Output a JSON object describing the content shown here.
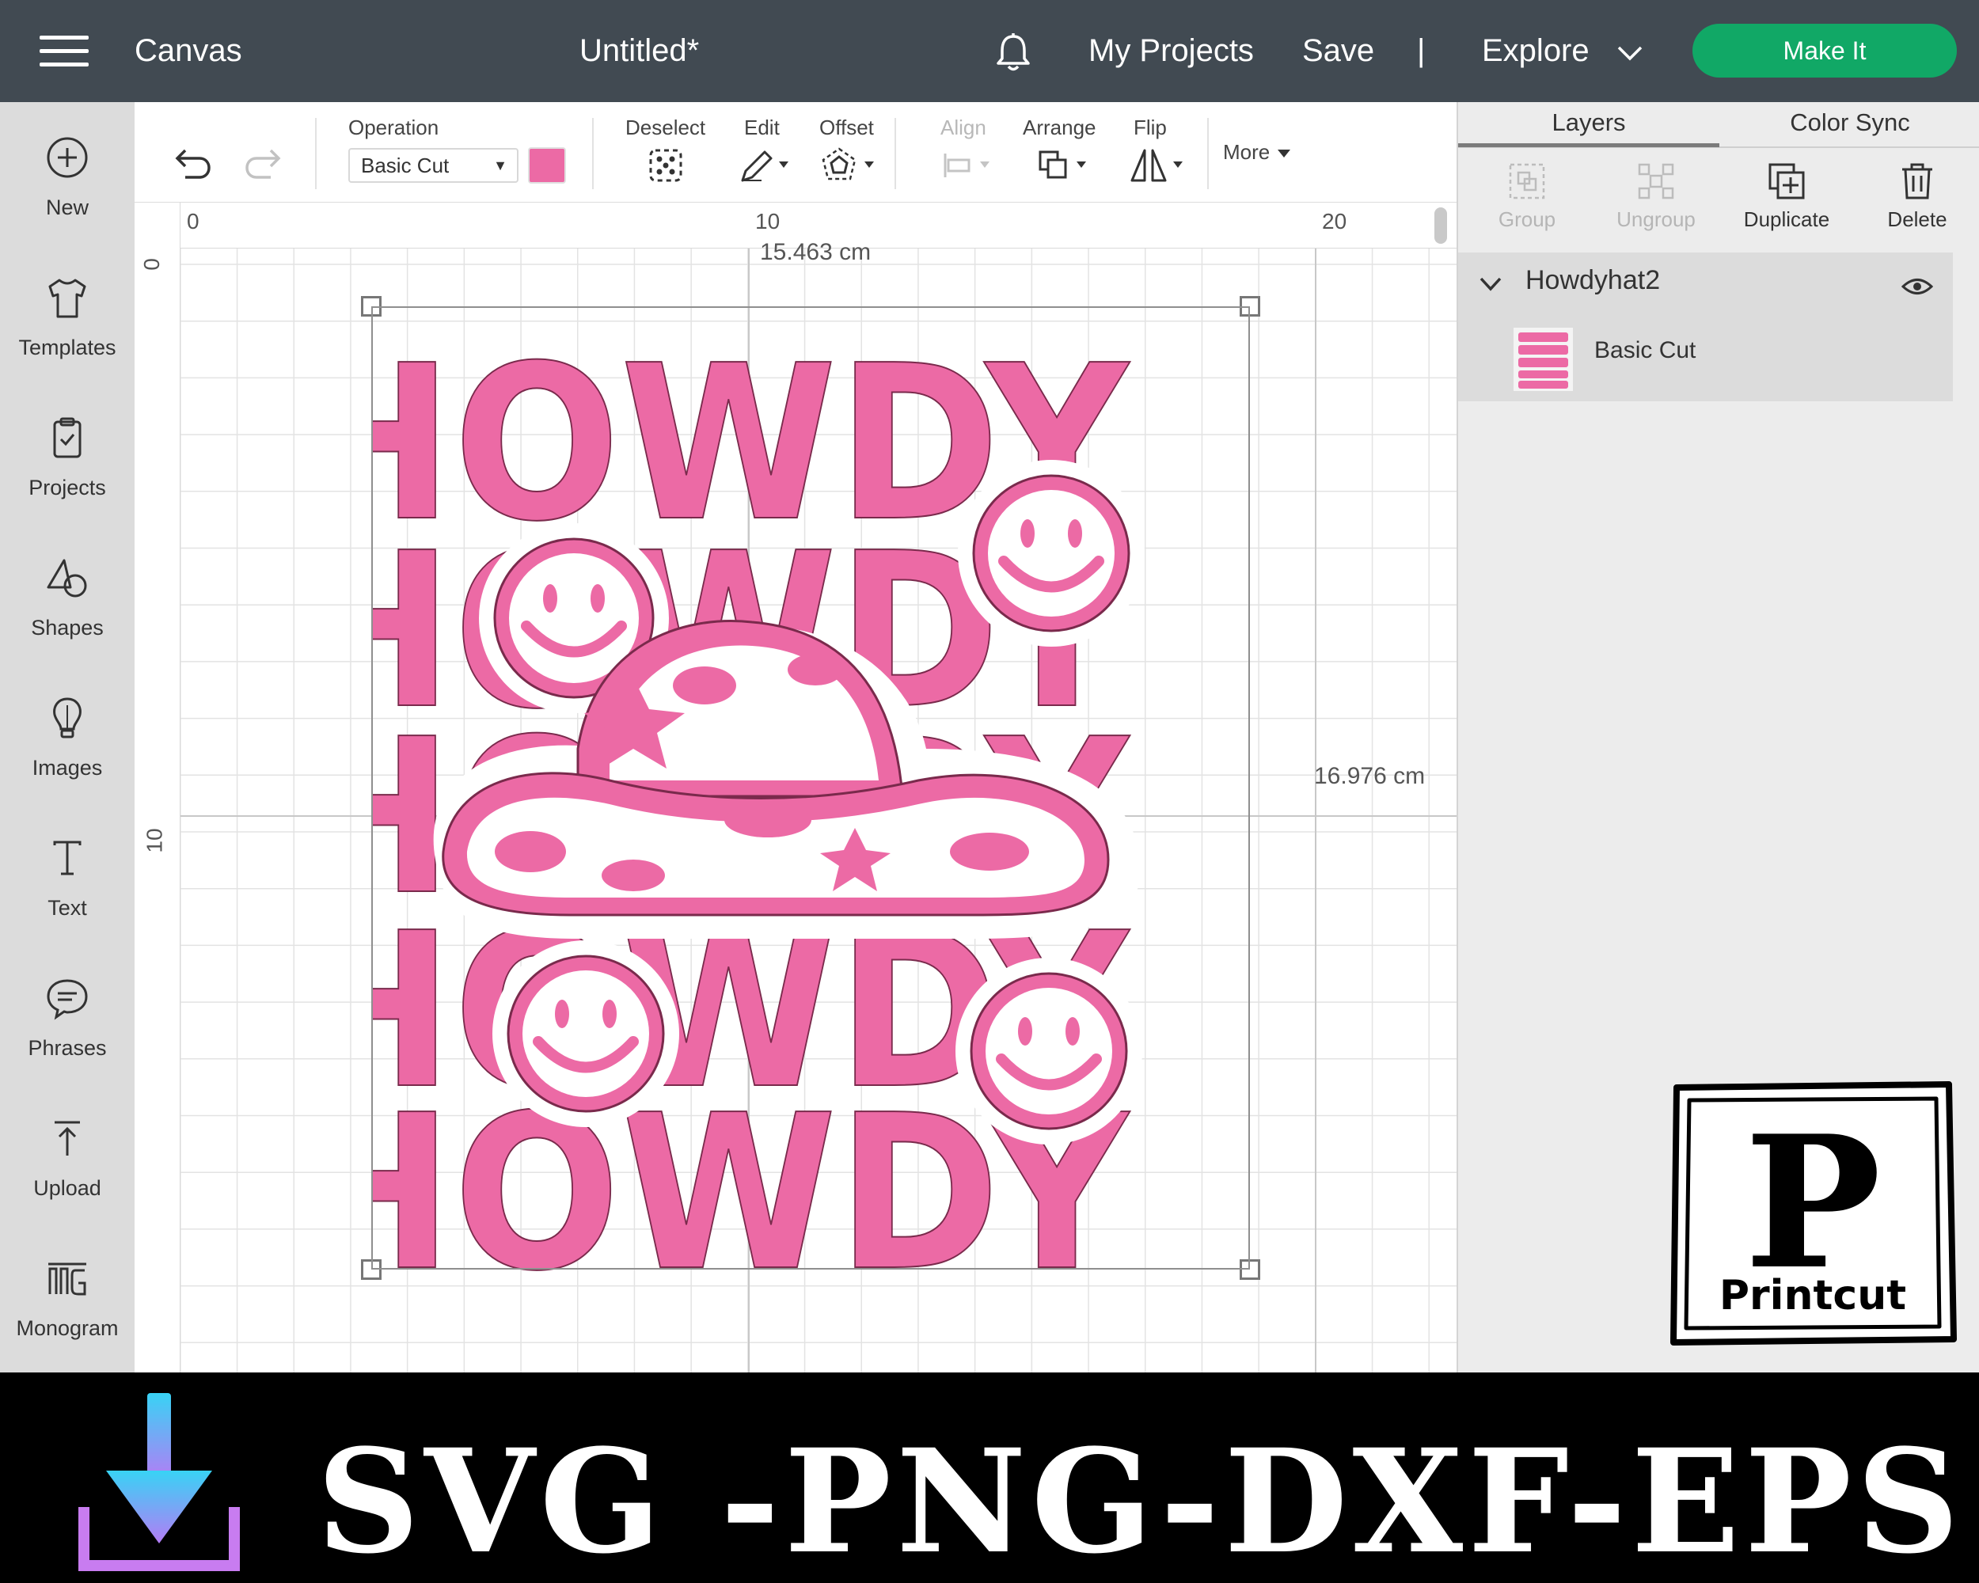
{
  "topbar": {
    "app_title": "Canvas",
    "doc_title": "Untitled*",
    "my_projects": "My Projects",
    "save": "Save",
    "separator": "|",
    "explore": "Explore",
    "make_it": "Make It"
  },
  "sidebar": {
    "items": [
      {
        "label": "New",
        "icon": "plus-circle-icon"
      },
      {
        "label": "Templates",
        "icon": "tshirt-icon"
      },
      {
        "label": "Projects",
        "icon": "clipboard-icon"
      },
      {
        "label": "Shapes",
        "icon": "shapes-icon"
      },
      {
        "label": "Images",
        "icon": "lightbulb-icon"
      },
      {
        "label": "Text",
        "icon": "text-icon"
      },
      {
        "label": "Phrases",
        "icon": "speech-bubble-icon"
      },
      {
        "label": "Upload",
        "icon": "upload-icon"
      },
      {
        "label": "Monogram",
        "icon": "monogram-icon"
      }
    ]
  },
  "toolbar": {
    "operation_label": "Operation",
    "operation_value": "Basic Cut",
    "operation_color": "#ec6aa5",
    "deselect": "Deselect",
    "edit": "Edit",
    "offset": "Offset",
    "align": "Align",
    "arrange": "Arrange",
    "flip": "Flip",
    "more": "More"
  },
  "canvas": {
    "ruler_top": [
      "0",
      "10",
      "20"
    ],
    "ruler_left": [
      "0",
      "10"
    ],
    "width_label": "15.463 cm",
    "height_label": "16.976 cm",
    "design_rows": [
      "HOWDY",
      "HOWDY",
      "HOWDY",
      "HOWDY",
      "HOWDY"
    ],
    "design_color": "#ec6aa5",
    "watermark": "Printcut"
  },
  "panel": {
    "tabs": [
      "Layers",
      "Color Sync"
    ],
    "buttons": {
      "group": "Group",
      "ungroup": "Ungroup",
      "duplicate": "Duplicate",
      "delete": "Delete"
    },
    "layer_name": "Howdyhat2",
    "layer_operation": "Basic Cut"
  },
  "logo": {
    "letter": "P",
    "brand": "Printcut"
  },
  "banner": {
    "formats": "SVG -PNG-DXF-EPS"
  }
}
